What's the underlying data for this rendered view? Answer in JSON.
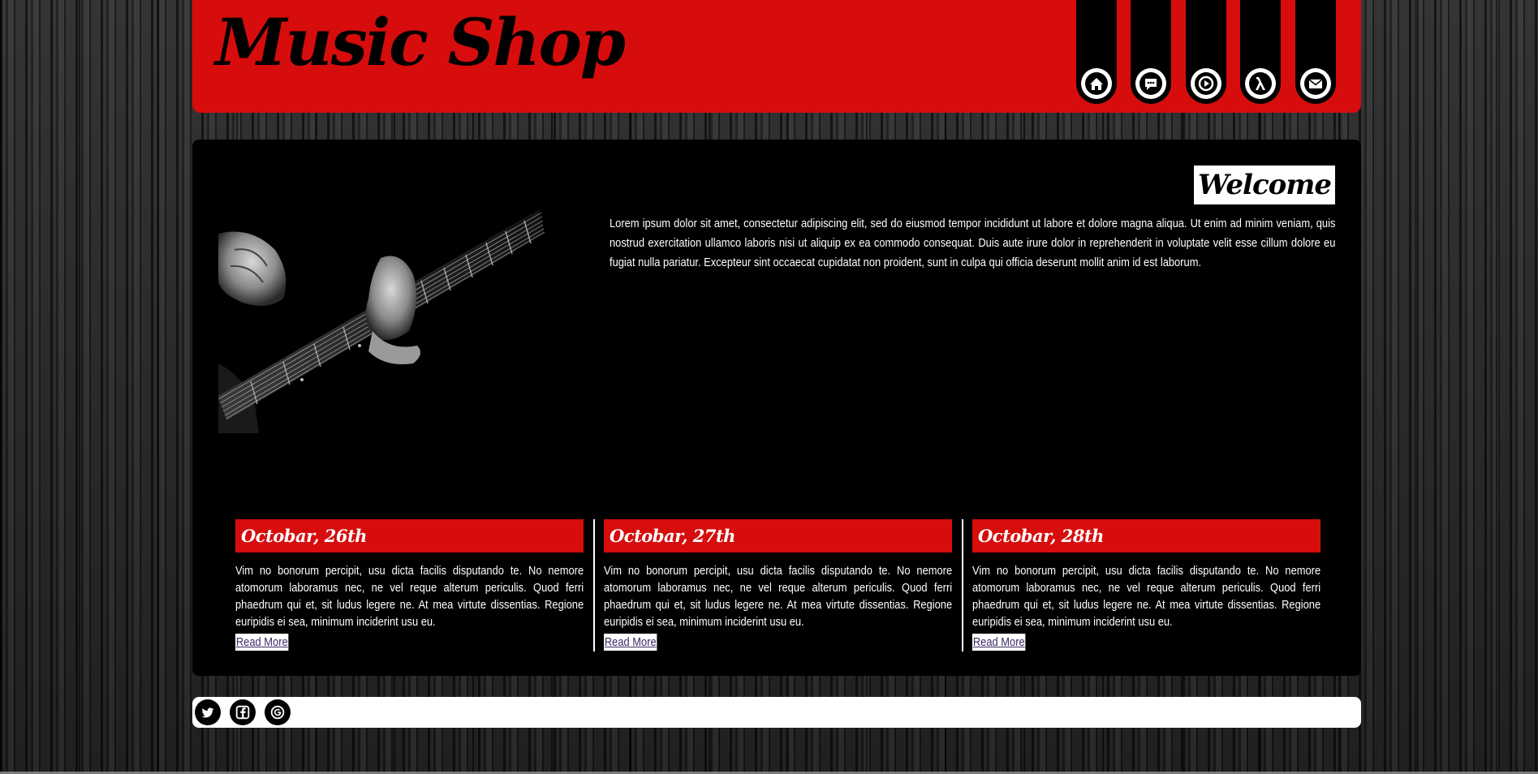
{
  "header": {
    "logo": "Music Shop",
    "nav": [
      {
        "icon": "home-icon"
      },
      {
        "icon": "chat-icon"
      },
      {
        "icon": "play-icon"
      },
      {
        "icon": "lambda-icon"
      },
      {
        "icon": "mail-icon"
      }
    ]
  },
  "main": {
    "welcome": "Welcome",
    "intro": "Lorem ipsum dolor sit amet, consectetur adipiscing elit, sed do eiusmod tempor incididunt ut labore et dolore magna aliqua. Ut enim ad minim veniam, quis nostrud exercitation ullamco laboris nisi ut aliquip ex ea commodo consequat. Duis aute irure dolor in reprehenderit in voluptate velit esse cillum dolore eu fugiat nulla pariatur. Excepteur sint occaecat cupidatat non proident, sunt in culpa qui officia deserunt mollit anim id est laborum.",
    "news": [
      {
        "date": "Octobar, 26th",
        "body": "Vim no bonorum percipit, usu dicta facilis disputando te. No nemore atomorum laboramus nec, ne vel reque alterum periculis. Quod ferri phaedrum qui et, sit ludus legere ne. At mea virtute dissentias. Regione euripidis ei sea, minimum inciderint usu eu.",
        "link": "Read More"
      },
      {
        "date": "Octobar, 27th",
        "body": "Vim no bonorum percipit, usu dicta facilis disputando te. No nemore atomorum laboramus nec, ne vel reque alterum periculis. Quod ferri phaedrum qui et, sit ludus legere ne. At mea virtute dissentias. Regione euripidis ei sea, minimum inciderint usu eu.",
        "link": "Read More"
      },
      {
        "date": "Octobar, 28th",
        "body": "Vim no bonorum percipit, usu dicta facilis disputando te. No nemore atomorum laboramus nec, ne vel reque alterum periculis. Quod ferri phaedrum qui et, sit ludus legere ne. At mea virtute dissentias. Regione euripidis ei sea, minimum inciderint usu eu.",
        "link": "Read More"
      }
    ]
  },
  "footer": {
    "social": [
      {
        "icon": "twitter-icon"
      },
      {
        "icon": "facebook-icon"
      },
      {
        "icon": "google-plus-icon"
      }
    ]
  },
  "colors": {
    "accent": "#d70c0c",
    "panel": "#000000",
    "text": "#ffffff"
  }
}
